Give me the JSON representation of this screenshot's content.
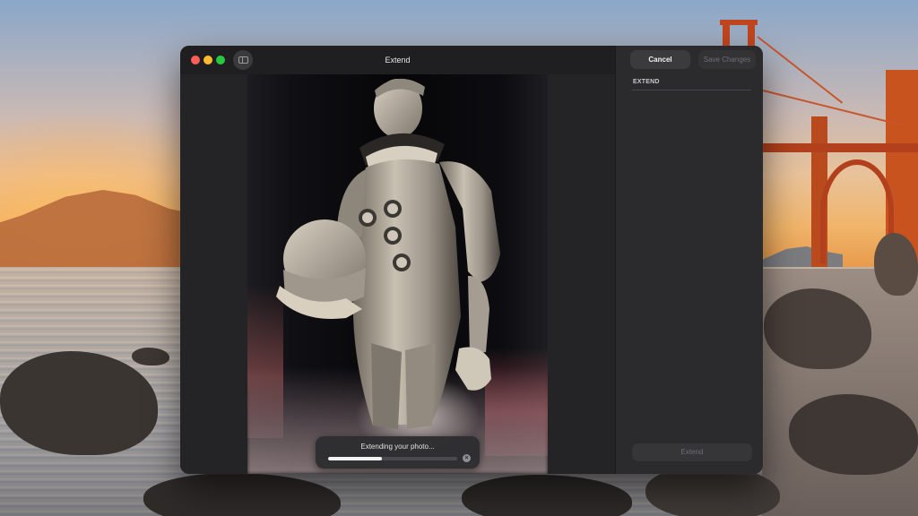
{
  "window": {
    "title": "Extend"
  },
  "toolbar": {
    "cancel_label": "Cancel",
    "save_label": "Save Changes"
  },
  "panel": {
    "section_label": "EXTEND",
    "extend_button_label": "Extend"
  },
  "progress": {
    "label": "Extending your photo...",
    "fraction": 0.42
  },
  "icons": {
    "close": "close-icon",
    "minimize": "minimize-icon",
    "zoom": "zoom-icon",
    "sidebar": "sidebar-toggle-icon",
    "cancel_progress": "cancel-icon"
  },
  "colors": {
    "traffic_red": "#fe5f57",
    "traffic_yellow": "#febc2e",
    "traffic_green": "#28c840",
    "window_bg": "#232325",
    "panel_bg": "#2b2b2d"
  }
}
